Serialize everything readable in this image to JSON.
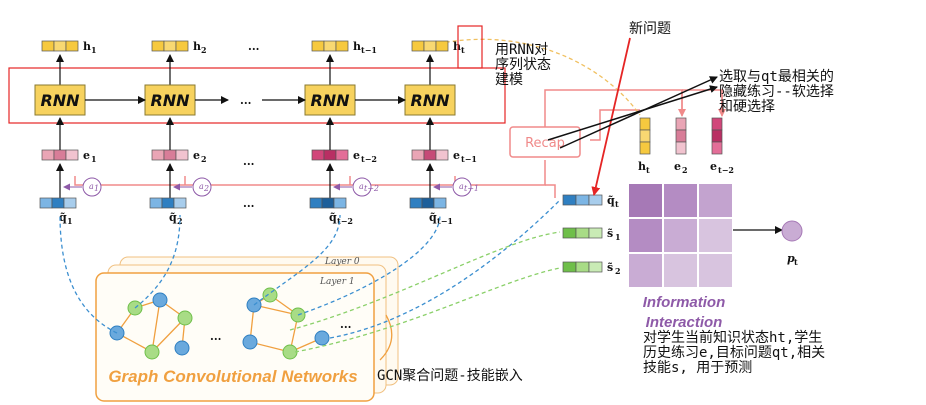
{
  "rnn": {
    "cell_label": "RNN",
    "recap_label": "Recap"
  },
  "hidden_labels": [
    "h",
    "h",
    "h",
    "h"
  ],
  "hidden_subs": [
    "1",
    "2",
    "t−1",
    "t"
  ],
  "embed_labels": [
    "e",
    "e",
    "e",
    "e"
  ],
  "embed_subs": [
    "1",
    "2",
    "t−2",
    "t−1"
  ],
  "question_labels": [
    "q̃",
    "q̃",
    "q̃",
    "q̃"
  ],
  "question_subs": [
    "1",
    "2",
    "t−2",
    "t−1"
  ],
  "attention_labels": [
    "a",
    "a",
    "a",
    "a"
  ],
  "attention_subs": [
    "1",
    "2",
    "t−2",
    "t−1"
  ],
  "ellipsis": "...",
  "gcn": {
    "title": "Graph Convolutional Networks",
    "layer0": "Layer 0",
    "layer1": "Layer 1",
    "dots": "..."
  },
  "interaction": {
    "title_line1": "Information",
    "title_line2": "Interaction",
    "top_labels": [
      "h",
      "e",
      "e"
    ],
    "top_subs": [
      "t",
      "2",
      "t−2"
    ],
    "side_labels": [
      "q̃",
      "s̃",
      "s̃"
    ],
    "side_subs": [
      "t",
      "1",
      "2"
    ],
    "output_label": "p",
    "output_sub": "t"
  },
  "annotations": {
    "new_question": "新问题",
    "rnn_note": "用RNN对\n序列状态\n建模",
    "select_note": "选取与qt最相关的\n隐藏练习--软选择\n和硬选择",
    "interaction_note": "对学生当前知识状态ht,学生\n历史练习e,目标问题qt,相关\n技能s, 用于预测",
    "gcn_note": "GCN聚合问题-技能嵌入"
  },
  "colors": {
    "rnn_fill": "#f7d25e",
    "hidden_fill": "#f6c93f",
    "embed_fill": "#e796aa",
    "question_fill": "#2f7fc1",
    "skill_fill": "#6fbf4a",
    "gcn_border": "#f0a040",
    "recap": "#f08a8a",
    "red_line": "#e52525",
    "matrix_dark": "#a679b6",
    "matrix_light": "#d8c4df",
    "attention": "#8e5aa8"
  }
}
